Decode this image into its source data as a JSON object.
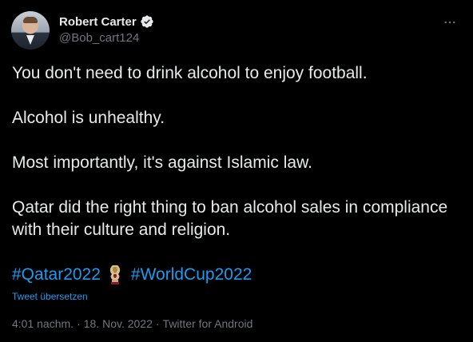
{
  "author": {
    "display_name": "Robert Carter",
    "handle": "@Bob_cart124",
    "verified": true
  },
  "icons": {
    "more": "more-horizontal-icon",
    "verified": "verified-badge-icon",
    "trophy": "world-cup-trophy-icon"
  },
  "tweet": {
    "paragraphs": [
      "You don't need to drink alcohol to enjoy football.",
      "Alcohol is unhealthy.",
      "Most importantly, it's against Islamic law.",
      "Qatar did the right thing to ban alcohol sales in compliance with their culture and religion."
    ],
    "hashtags": [
      "#Qatar2022",
      "#WorldCup2022"
    ],
    "translate_label": "Tweet übersetzen",
    "time": "4:01 nachm.",
    "date": "18. Nov. 2022",
    "source": "Twitter for Android",
    "separator": "·"
  },
  "colors": {
    "background": "#000000",
    "text": "#e7e9ea",
    "secondary": "#71767b",
    "accent": "#1d9bf0"
  }
}
